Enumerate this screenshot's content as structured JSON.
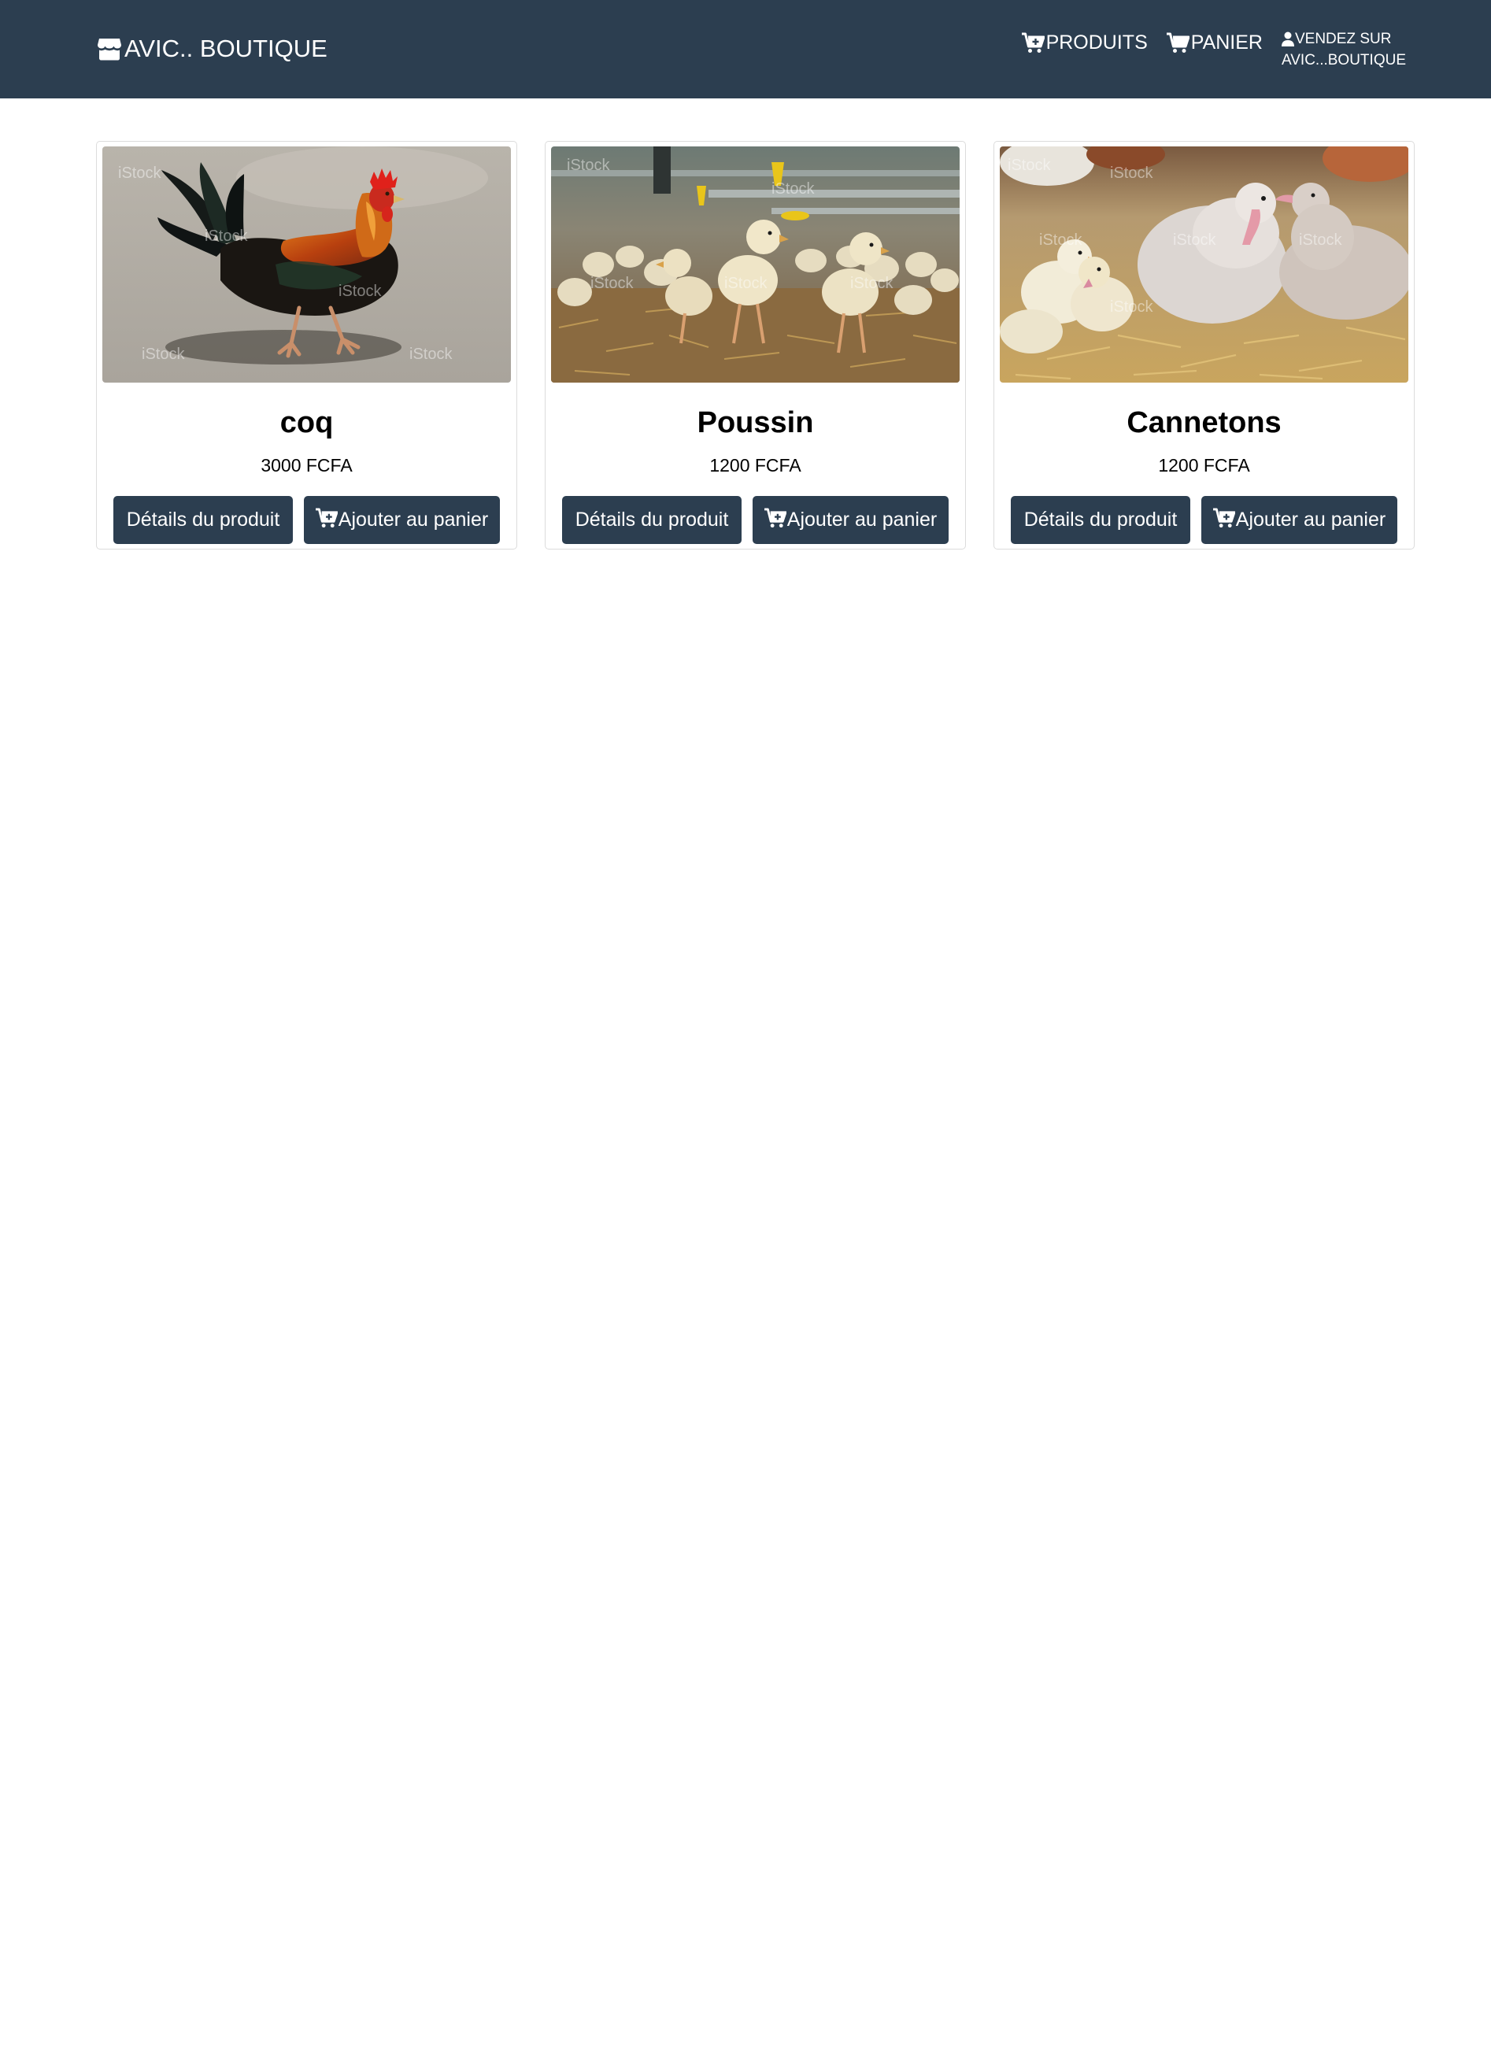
{
  "navbar": {
    "brand": "AVIC.. BOUTIQUE",
    "brand_icon": "store-icon",
    "links": [
      {
        "label": "PRODUITS",
        "icon": "cart-plus-icon"
      },
      {
        "label": "PANIER",
        "icon": "cart-icon"
      }
    ],
    "seller": {
      "line1": "VENDEZ SUR",
      "line2": "AVIC...BOUTIQUE",
      "icon": "user-icon"
    },
    "background": "#2c3e50"
  },
  "products": [
    {
      "name": "coq",
      "price": "3000 FCFA",
      "details_label": "Détails du produit",
      "add_label": "Ajouter au panier",
      "watermark": "iStock"
    },
    {
      "name": "Poussin",
      "price": "1200 FCFA",
      "details_label": "Détails du produit",
      "add_label": "Ajouter au panier",
      "watermark": "iStock"
    },
    {
      "name": "Cannetons",
      "price": "1200 FCFA",
      "details_label": "Détails du produit",
      "add_label": "Ajouter au panier",
      "watermark": "iStock"
    }
  ],
  "colors": {
    "primary": "#2c3e50",
    "card_border": "#dcdcdc"
  }
}
